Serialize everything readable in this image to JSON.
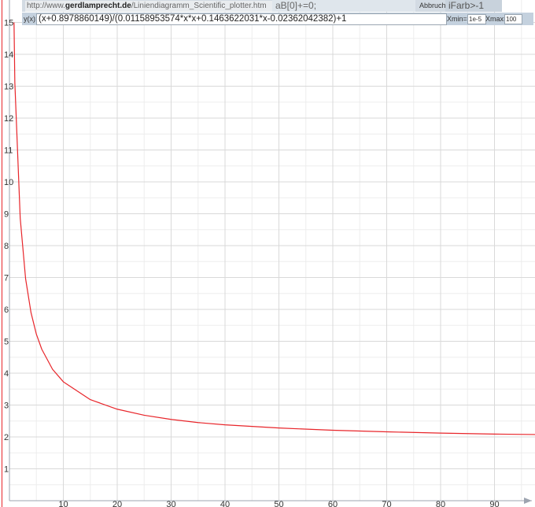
{
  "toolbar": {
    "url_prefix": "http://www.",
    "url_domain": "gerdlamprecht.de",
    "url_path": "/Liniendiagramm_Scientific_plotter.htm",
    "code_value": "aB[0]+=0;",
    "abbruch_label": "Abbruch:",
    "abbruch_value": "iFarb>-1",
    "y_label": "y(x):",
    "formula": "(x+0.8978860149)/(0.01158953574*x*x+0.1463622031*x-0.02362042382)+1",
    "xmin_label": "Xmin=",
    "xmin_value": "1e-5",
    "xmax_label": "Xmax=",
    "xmax_value": "100"
  },
  "chart_data": {
    "type": "line",
    "title": "",
    "xlabel": "",
    "ylabel": "",
    "xlim": [
      0,
      100
    ],
    "ylim": [
      0,
      15
    ],
    "x_ticks": [
      10,
      20,
      30,
      40,
      50,
      60,
      70,
      80,
      90
    ],
    "y_ticks": [
      1,
      2,
      3,
      4,
      5,
      6,
      7,
      8,
      9,
      10,
      11,
      12,
      13,
      14,
      15
    ],
    "grid": true,
    "series": [
      {
        "color": "#e8252a",
        "x": [
          0.85,
          1,
          2,
          3,
          4,
          5,
          6,
          8,
          10,
          15,
          20,
          25,
          30,
          35,
          40,
          50,
          60,
          70,
          80,
          90,
          100
        ],
        "y": [
          15.0,
          13.12,
          8.86,
          6.96,
          5.9,
          5.22,
          4.75,
          4.12,
          3.73,
          3.17,
          2.87,
          2.68,
          2.55,
          2.45,
          2.38,
          2.28,
          2.21,
          2.16,
          2.12,
          2.09,
          2.07
        ]
      }
    ]
  }
}
